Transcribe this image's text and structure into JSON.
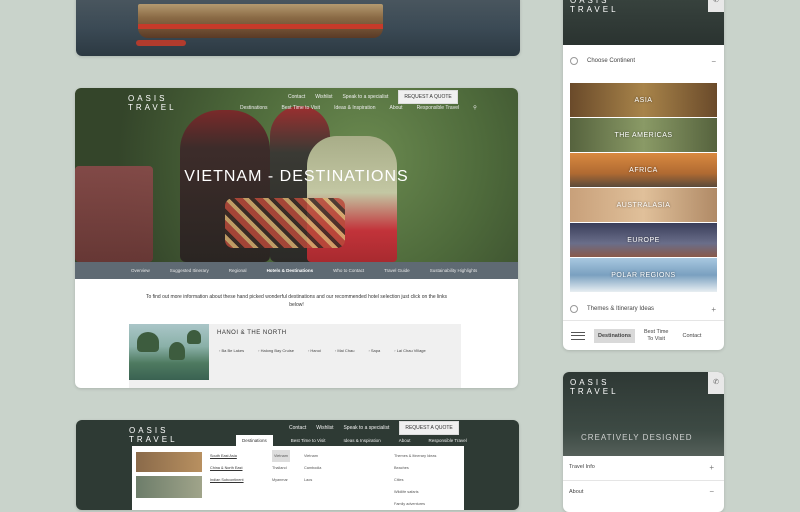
{
  "brand": {
    "logo_line1": "OASIS",
    "logo_line2": "TRAVEL"
  },
  "topnav": {
    "contact": "Contact",
    "wishlist": "Wishlist",
    "specialist": "Speak to a specialist",
    "quote": "REQUEST A QUOTE"
  },
  "subnav": [
    "Destinations",
    "Best Time to Visit",
    "Ideas & Inspiration",
    "About",
    "Responsible Travel"
  ],
  "hero": {
    "title": "VIETNAM - DESTINATIONS"
  },
  "tabs": [
    "Overview",
    "Suggested Itinerary",
    "Regional",
    "Hotels & Destinations",
    "Who to Contact",
    "Travel Guide",
    "Sustainability Highlights"
  ],
  "tabs_active_index": 3,
  "intro": "To find out more information about these hand picked wonderful destinations and our recommended hotel selection just click on the links below!",
  "region": {
    "name": "HANOI & THE NORTH",
    "links": [
      "Ba Be Lakes",
      "Halong Bay Cruise",
      "Hanoi",
      "Mai Chau",
      "Sapa",
      "Lai Chau Village"
    ]
  },
  "menu_dropdown": {
    "col_a": [
      "South East Asia",
      "China & North East",
      "Indian Subcontinent"
    ],
    "col_b": [
      "Vietnam",
      "Thailand",
      "Myanmar"
    ],
    "col_c": [
      "Vietnam",
      "Cambodia",
      "Laos"
    ],
    "col_d_title": "Themes & Itinerary Ideas",
    "col_d": [
      "Beaches",
      "Cities",
      "Wildlife safaris",
      "Family adventures"
    ]
  },
  "mobile": {
    "choose_continent": "Choose Continent",
    "continents": [
      {
        "name": "ASIA",
        "color": "#8a6a40"
      },
      {
        "name": "THE AMERICAS",
        "color": "#6f7a52"
      },
      {
        "name": "AFRICA",
        "color": "#c27a3a"
      },
      {
        "name": "AUSTRALASIA",
        "color": "#c9a27a"
      },
      {
        "name": "EUROPE",
        "color": "#5a5f7a"
      },
      {
        "name": "POLAR REGIONS",
        "color": "#8aaec8"
      }
    ],
    "themes": "Themes & Itinerary Ideas",
    "bottom": {
      "destinations": "Destinations",
      "best_time_1": "Best Time",
      "best_time_2": "To Visit",
      "contact": "Contact"
    }
  },
  "mobile2": {
    "overlay_title": "CREATIVELY DESIGNED",
    "travel_info": "Travel Info",
    "about": "About"
  }
}
